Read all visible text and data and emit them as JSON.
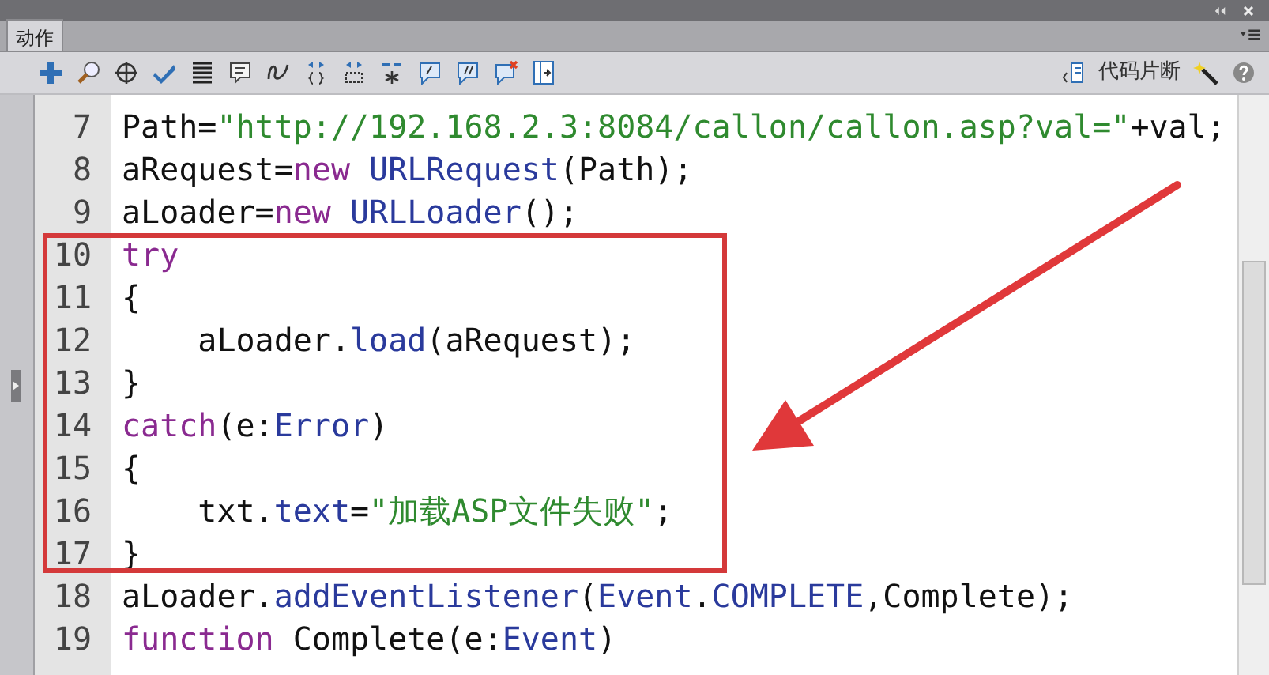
{
  "panel": {
    "tab": {
      "label": "动作",
      "selected": true
    }
  },
  "toolbar": {
    "snippets_label": "代码片断"
  },
  "code": {
    "lines": [
      {
        "number": "7",
        "boxed": false,
        "tokens": [
          {
            "kind": "plain",
            "text": "Path="
          },
          {
            "kind": "string",
            "text": "\"http://192.168.2.3:8084/callon/callon.asp?val=\""
          },
          {
            "kind": "plain",
            "text": "+val;"
          }
        ]
      },
      {
        "number": "8",
        "boxed": false,
        "tokens": [
          {
            "kind": "plain",
            "text": "aRequest="
          },
          {
            "kind": "keyword",
            "text": "new "
          },
          {
            "kind": "builtin",
            "text": "URLRequest"
          },
          {
            "kind": "plain",
            "text": "(Path);"
          }
        ]
      },
      {
        "number": "9",
        "boxed": false,
        "tokens": [
          {
            "kind": "plain",
            "text": "aLoader="
          },
          {
            "kind": "keyword",
            "text": "new "
          },
          {
            "kind": "builtin",
            "text": "URLLoader"
          },
          {
            "kind": "plain",
            "text": "();"
          }
        ]
      },
      {
        "number": "10",
        "boxed": true,
        "tokens": [
          {
            "kind": "keyword",
            "text": "try"
          }
        ]
      },
      {
        "number": "11",
        "boxed": true,
        "tokens": [
          {
            "kind": "plain",
            "text": "{"
          }
        ]
      },
      {
        "number": "12",
        "boxed": true,
        "tokens": [
          {
            "kind": "plain",
            "text": "    aLoader."
          },
          {
            "kind": "builtin",
            "text": "load"
          },
          {
            "kind": "plain",
            "text": "(aRequest);"
          }
        ]
      },
      {
        "number": "13",
        "boxed": true,
        "tokens": [
          {
            "kind": "plain",
            "text": "}"
          }
        ]
      },
      {
        "number": "14",
        "boxed": true,
        "tokens": [
          {
            "kind": "keyword",
            "text": "catch"
          },
          {
            "kind": "plain",
            "text": "(e:"
          },
          {
            "kind": "builtin",
            "text": "Error"
          },
          {
            "kind": "plain",
            "text": ")"
          }
        ]
      },
      {
        "number": "15",
        "boxed": true,
        "tokens": [
          {
            "kind": "plain",
            "text": "{"
          }
        ]
      },
      {
        "number": "16",
        "boxed": true,
        "tokens": [
          {
            "kind": "plain",
            "text": "    txt."
          },
          {
            "kind": "builtin",
            "text": "text"
          },
          {
            "kind": "plain",
            "text": "="
          },
          {
            "kind": "string",
            "text": "\"加载ASP文件失败\""
          },
          {
            "kind": "plain",
            "text": ";"
          }
        ]
      },
      {
        "number": "17",
        "boxed": true,
        "tokens": [
          {
            "kind": "plain",
            "text": "}"
          }
        ]
      },
      {
        "number": "18",
        "boxed": false,
        "tokens": [
          {
            "kind": "plain",
            "text": "aLoader."
          },
          {
            "kind": "builtin",
            "text": "addEventListener"
          },
          {
            "kind": "plain",
            "text": "("
          },
          {
            "kind": "builtin",
            "text": "Event"
          },
          {
            "kind": "plain",
            "text": "."
          },
          {
            "kind": "builtin",
            "text": "COMPLETE"
          },
          {
            "kind": "plain",
            "text": ",Complete);"
          }
        ]
      },
      {
        "number": "19",
        "boxed": false,
        "tokens": [
          {
            "kind": "keyword",
            "text": "function"
          },
          {
            "kind": "plain",
            "text": " Complete(e:"
          },
          {
            "kind": "builtin",
            "text": "Event"
          },
          {
            "kind": "plain",
            "text": ")"
          }
        ]
      }
    ]
  }
}
